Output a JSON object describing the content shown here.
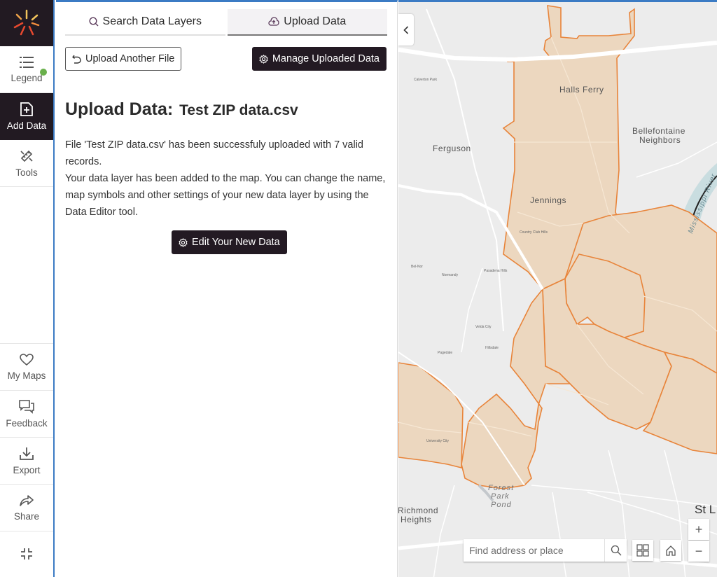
{
  "rail": {
    "logo": "app-logo",
    "items": [
      {
        "label": "Legend",
        "icon": "list-icon",
        "status_dot_color": "#6ab04c"
      },
      {
        "label": "Add Data",
        "icon": "add-file-icon",
        "active": true
      },
      {
        "label": "Tools",
        "icon": "tools-icon"
      },
      {
        "label": "My Maps",
        "icon": "heart-icon"
      },
      {
        "label": "Feedback",
        "icon": "chat-icon"
      },
      {
        "label": "Export",
        "icon": "download-icon"
      },
      {
        "label": "Share",
        "icon": "share-icon"
      }
    ],
    "collapse_icon": "minimize-icon"
  },
  "panel": {
    "tabs": [
      {
        "label": "Search Data Layers",
        "icon": "search-icon",
        "active": false
      },
      {
        "label": "Upload Data",
        "icon": "cloud-upload-icon",
        "active": true
      }
    ],
    "upload_another_label": "Upload Another File",
    "manage_label": "Manage Uploaded Data",
    "title_prefix": "Upload Data:",
    "title_file": "Test ZIP data.csv",
    "message_line1": "File 'Test ZIP data.csv' has been successfuly uploaded with 7 valid records.",
    "message_line2": "Your data layer has been added to the map. You can change the name, map symbols and other settings of your new data layer by using the Data Editor tool.",
    "edit_label": "Edit Your New Data"
  },
  "map": {
    "labels": {
      "halls_ferry": "Halls Ferry",
      "ferguson": "Ferguson",
      "bellefontaine": "Bellefontaine",
      "neighbors": "Neighbors",
      "jennings": "Jennings",
      "mississippi": "Mississippi River",
      "forest_park": "Forest",
      "park": "Park",
      "pond": "Pond",
      "richmond": "Richmond",
      "heights": "Heights",
      "st_louis": "St L",
      "university_city": "University City",
      "calverton_park": "Calverton Park",
      "country_club_hills": "Country Club Hills",
      "pasadena_hills": "Pasadena Hills",
      "velda_city": "Velda City",
      "hillsdale": "Hillsdale",
      "pagedale": "Pagedale",
      "normandy": "Normandy",
      "bel_nor": "Bel-Nor"
    },
    "search_placeholder": "Find address or place",
    "zoom_in": "+",
    "zoom_out": "−",
    "fill_color": "#ecd7bf",
    "outline_color": "#e8843a"
  }
}
